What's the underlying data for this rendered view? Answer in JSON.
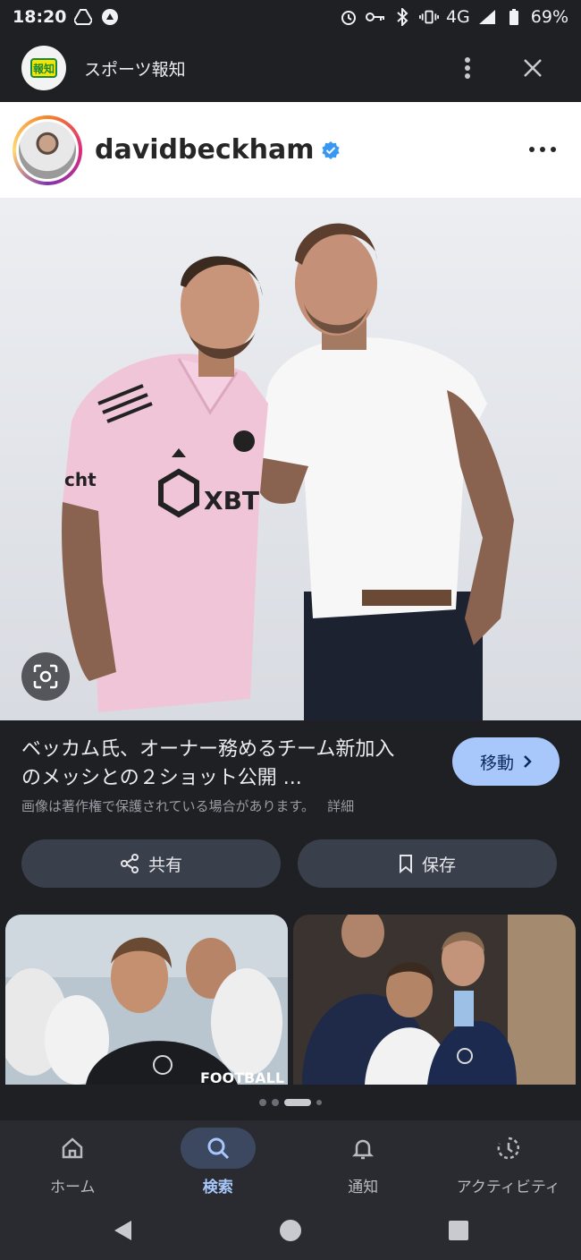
{
  "status_bar": {
    "time": "18:20",
    "network": "4G",
    "battery": "69%"
  },
  "header": {
    "site_logo_text": "報知",
    "site_title": "スポーツ報知"
  },
  "instagram": {
    "username": "davidbeckham"
  },
  "result": {
    "title_line1": "ベッカム氏、オーナー務めるチーム新加入",
    "title_line2": "のメッシとの２ショット公開 ...",
    "copyright_notice": "画像は著作権で保護されている場合があります。",
    "details_label": "詳細",
    "visit_label": "移動"
  },
  "actions": {
    "share_label": "共有",
    "save_label": "保存"
  },
  "photo_text": {
    "jersey_sponsor": "XBT",
    "jersey_side": "cht"
  },
  "thumbnails": {
    "thumb1_caption": "FOOTBALL"
  },
  "bottom_nav": {
    "items": [
      {
        "label": "ホーム"
      },
      {
        "label": "検索"
      },
      {
        "label": "通知"
      },
      {
        "label": "アクティビティ"
      }
    ]
  },
  "colors": {
    "accent": "#a8c7fa",
    "background": "#1f2024",
    "button_bg": "#3a3f4c"
  }
}
